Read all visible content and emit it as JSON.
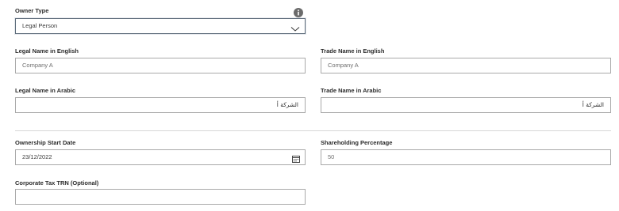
{
  "owner_type": {
    "label": "Owner Type",
    "value": "Legal Person"
  },
  "legal_name_english": {
    "label": "Legal Name in English",
    "value": "Company A"
  },
  "trade_name_english": {
    "label": "Trade Name in English",
    "value": "Company A"
  },
  "legal_name_arabic": {
    "label": "Legal Name in Arabic",
    "value": "الشركة أ"
  },
  "trade_name_arabic": {
    "label": "Trade Name in Arabic",
    "value": "الشركة أ"
  },
  "ownership_start_date": {
    "label": "Ownership Start Date",
    "value": "23/12/2022"
  },
  "shareholding_percentage": {
    "label": "Shareholding Percentage",
    "value": "50"
  },
  "corporate_tax_trn": {
    "label": "Corporate Tax TRN (Optional)",
    "value": ""
  },
  "icons": {
    "info": "info-icon",
    "dropdown": "chevron-down-icon",
    "calendar": "calendar-icon"
  },
  "colors": {
    "input_border": "#a9a9a9",
    "select_border": "#5c6b7a",
    "label_text": "#2b2b2b",
    "value_text": "#6e6e6e",
    "info_icon": "#6b6b6b"
  }
}
